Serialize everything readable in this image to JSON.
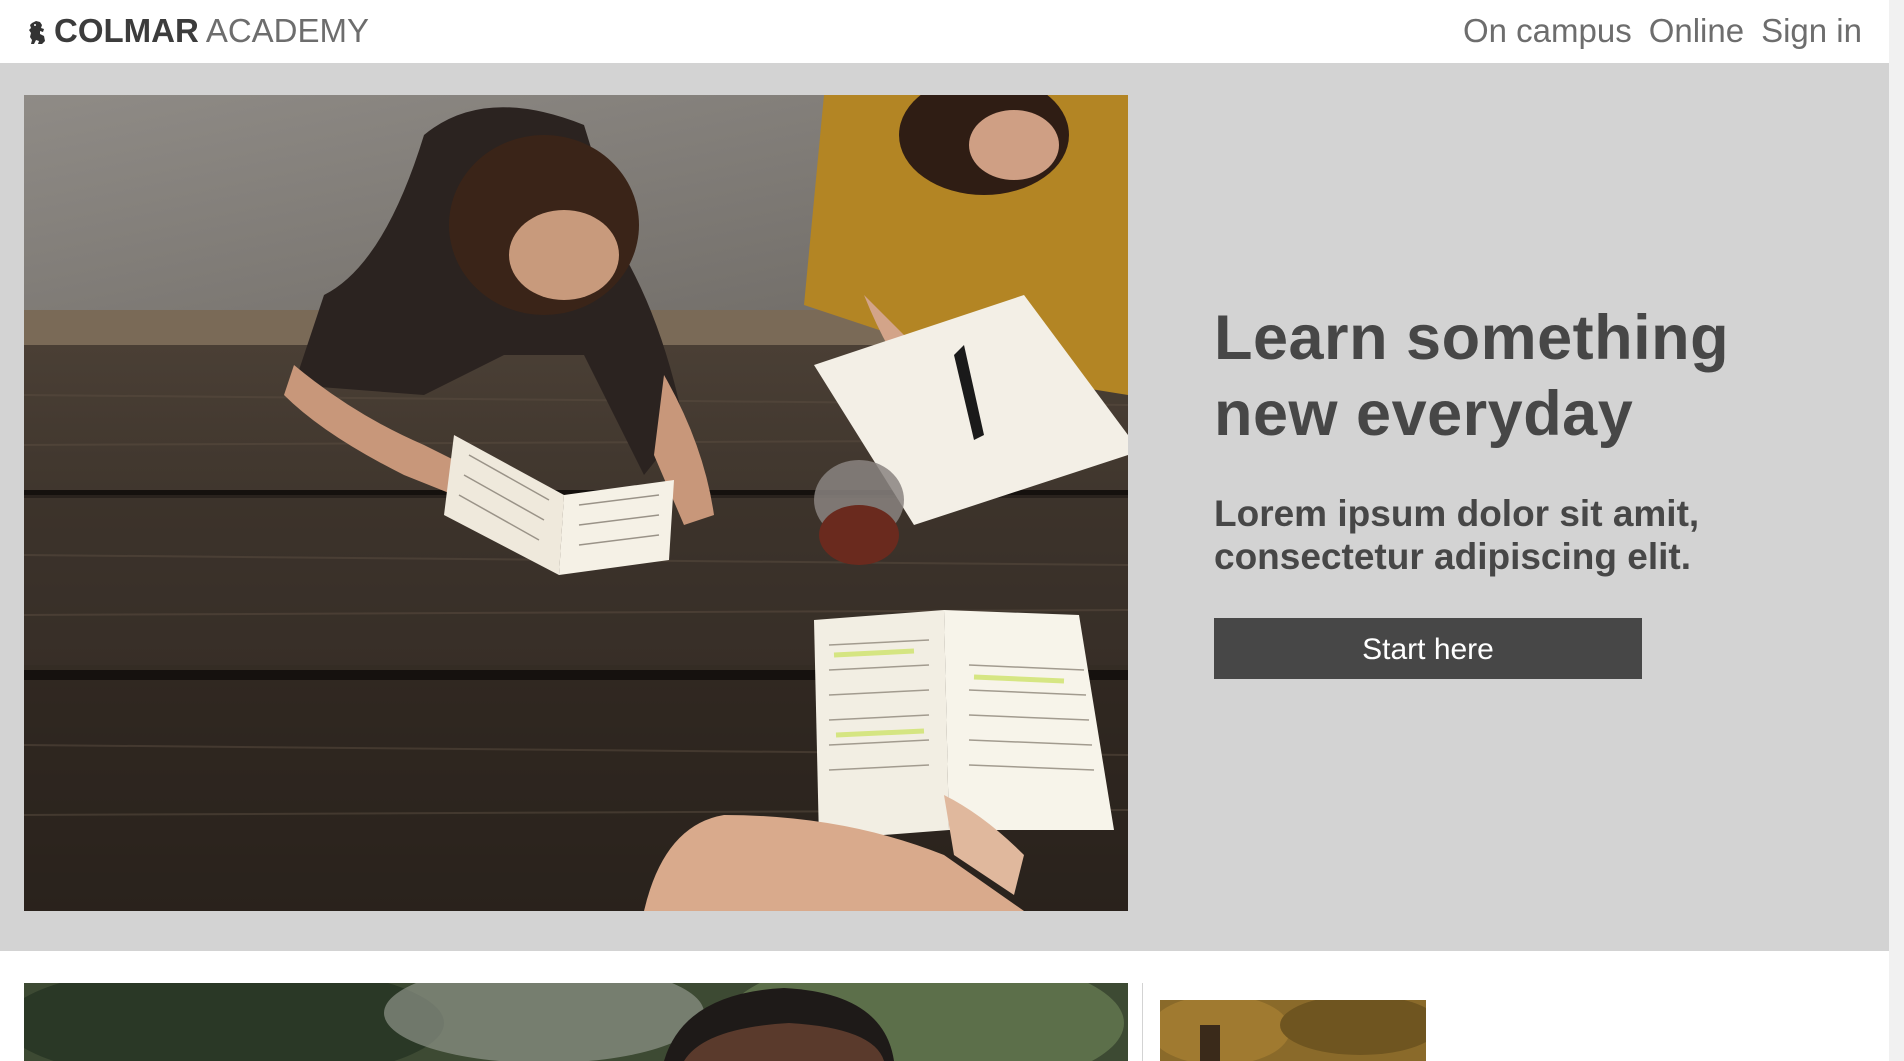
{
  "header": {
    "logo_bold": "COLMAR",
    "logo_light": "ACADEMY",
    "logo_icon": "lion-icon",
    "nav": [
      {
        "label": "On campus"
      },
      {
        "label": "Online"
      },
      {
        "label": "Sign in"
      }
    ]
  },
  "hero": {
    "title_line1": "Learn something",
    "title_line2": "new everyday",
    "subtitle_line1": "Lorem ipsum dolor sit amit,",
    "subtitle_line2": "consectetur adipiscing elit.",
    "cta_label": "Start here"
  },
  "colors": {
    "hero_background": "#d3d3d3",
    "text_dark": "#474747",
    "button_background": "#474747",
    "button_text": "#ffffff",
    "nav_text": "#6d6d6d"
  }
}
